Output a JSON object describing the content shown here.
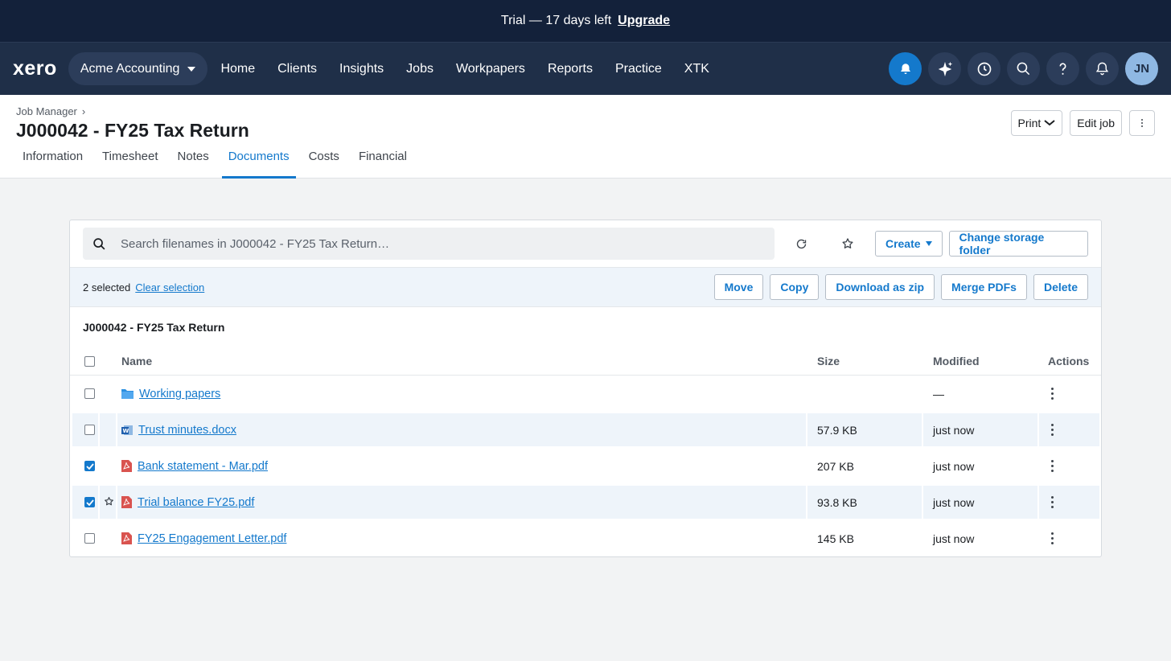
{
  "banner": {
    "text": "Trial — 17 days left",
    "upgrade_label": "Upgrade"
  },
  "nav": {
    "logo": "xero",
    "org": "Acme Accounting",
    "items": [
      "Home",
      "Clients",
      "Insights",
      "Jobs",
      "Workpapers",
      "Reports",
      "Practice",
      "XTK"
    ],
    "user_initials": "JN"
  },
  "header": {
    "breadcrumb": "Job Manager",
    "title": "J000042 - FY25 Tax Return",
    "tabs": [
      "Information",
      "Timesheet",
      "Notes",
      "Documents",
      "Costs",
      "Financial"
    ],
    "active_tab": "Documents",
    "print_label": "Print",
    "edit_label": "Edit job"
  },
  "toolbar": {
    "search_placeholder": "Search filenames in J000042 - FY25 Tax Return…",
    "create_label": "Create",
    "storage_label": "Change storage folder"
  },
  "selection": {
    "count_text": "2 selected",
    "clear_label": "Clear selection",
    "actions": [
      "Move",
      "Copy",
      "Download as zip",
      "Merge PDFs",
      "Delete"
    ]
  },
  "folder_title": "J000042 - FY25 Tax Return",
  "table": {
    "columns": {
      "name": "Name",
      "size": "Size",
      "modified": "Modified",
      "actions": "Actions"
    },
    "rows": [
      {
        "name": "Working papers",
        "type": "folder",
        "size": "",
        "modified": "—",
        "checked": false
      },
      {
        "name": "Trust minutes.docx",
        "type": "docx",
        "size": "57.9 KB",
        "modified": "just now",
        "checked": false
      },
      {
        "name": "Bank statement - Mar.pdf",
        "type": "pdf",
        "size": "207 KB",
        "modified": "just now",
        "checked": true
      },
      {
        "name": "Trial balance FY25.pdf",
        "type": "pdf",
        "size": "93.8 KB",
        "modified": "just now",
        "checked": true
      },
      {
        "name": "FY25 Engagement Letter.pdf",
        "type": "pdf",
        "size": "145 KB",
        "modified": "just now",
        "checked": false
      }
    ]
  },
  "colors": {
    "brand_dark": "#1f2f48",
    "accent": "#1479cc",
    "pdf_red": "#d9534f"
  }
}
